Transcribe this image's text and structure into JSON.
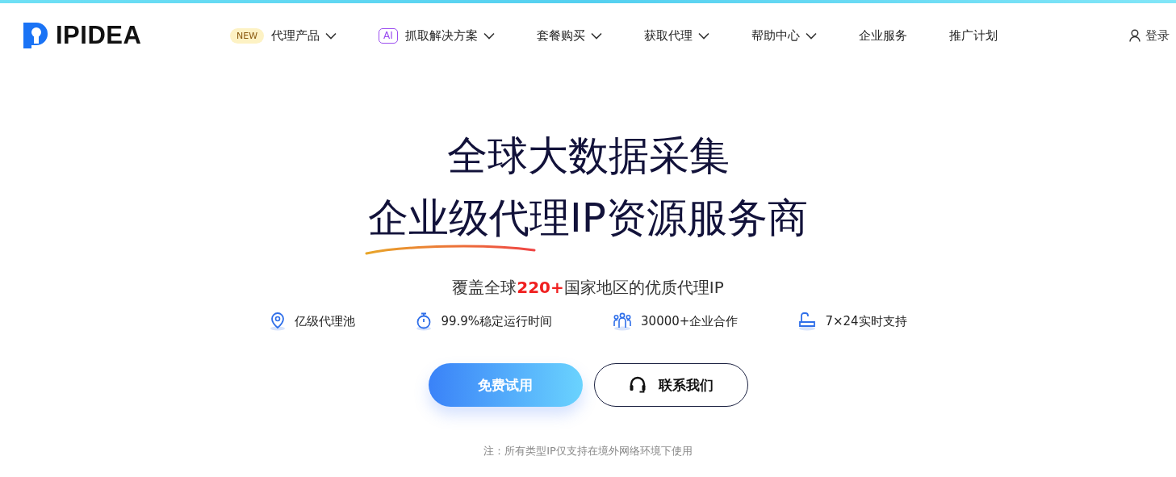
{
  "logo": {
    "text": "IPIDEA"
  },
  "nav": [
    {
      "label": "代理产品",
      "badge": {
        "kind": "new",
        "text": "NEW"
      },
      "has_menu": true
    },
    {
      "label": "抓取解决方案",
      "badge": {
        "kind": "ai",
        "text": "AI"
      },
      "has_menu": true
    },
    {
      "label": "套餐购买",
      "has_menu": true
    },
    {
      "label": "获取代理",
      "has_menu": true
    },
    {
      "label": "帮助中心",
      "has_menu": true
    },
    {
      "label": "企业服务",
      "has_menu": false
    },
    {
      "label": "推广计划",
      "has_menu": false
    }
  ],
  "login": "登录",
  "hero": {
    "line1": "全球大数据采集",
    "line2": "企业级代理IP资源服务商",
    "subtitle": {
      "before": "覆盖全球",
      "highlight": "220+",
      "after": "国家地区的优质代理IP"
    },
    "features": [
      {
        "kind": "pool",
        "text": "亿级代理池"
      },
      {
        "kind": "uptime",
        "text": "99.9%稳定运行时间"
      },
      {
        "kind": "partners",
        "text": "30000+企业合作"
      },
      {
        "kind": "support",
        "text": "7×24实时支持"
      }
    ],
    "buttons": [
      {
        "kind": "primary",
        "label": "免费试用"
      },
      {
        "kind": "contact",
        "label": "联系我们"
      }
    ],
    "note": "注：所有类型IP仅支持在境外网络环境下使用"
  }
}
